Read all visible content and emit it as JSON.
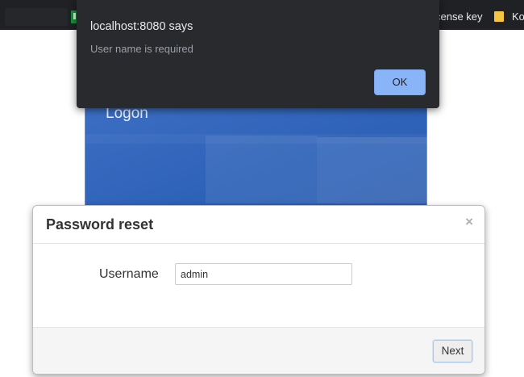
{
  "bookmarks_bar": {
    "items": [
      {
        "label": "cense key",
        "icon": "bookmark-icon"
      },
      {
        "label": "Ko",
        "icon": "folder-icon"
      }
    ]
  },
  "logon": {
    "title": "Logon"
  },
  "alert": {
    "title": "localhost:8080 says",
    "message": "User name is required",
    "ok_label": "OK"
  },
  "password_reset": {
    "title": "Password reset",
    "close_label": "×",
    "username_label": "Username",
    "username_value": "admin",
    "next_label": "Next"
  },
  "colors": {
    "alert_background": "#292a2d",
    "alert_button": "#8ab4f8",
    "logon_blue": "#2e62b8",
    "bookmarks_bar": "#202124"
  }
}
